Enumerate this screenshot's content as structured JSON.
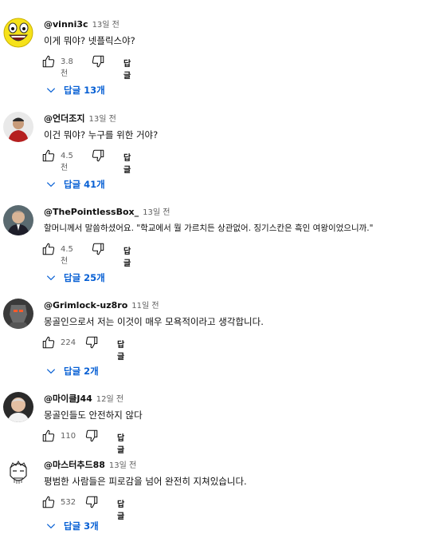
{
  "labels": {
    "reply": "답글"
  },
  "comments": [
    {
      "author": "@vinni3c",
      "time": "13일 전",
      "text": "이게 뭐야? 넷플릭스야?",
      "likes": "3.8천",
      "replies": "답글 13개"
    },
    {
      "author": "@언더조지",
      "time": "13일 전",
      "text": "이건 뭐야? 누구를 위한 거야?",
      "likes": "4.5천",
      "replies": "답글 41개"
    },
    {
      "author": "@ThePointlessBox_",
      "time": "13일 전",
      "text": "할머니께서 말씀하셨어요. \"학교에서 뭘 가르치든 상관없어. 징기스칸은 흑인 여왕이었으니까.\"",
      "likes": "4.5천",
      "replies": "답글 25개"
    },
    {
      "author": "@Grimlock-uz8ro",
      "time": "11일 전",
      "text": "몽골인으로서 저는 이것이 매우 모욕적이라고 생각합니다.",
      "likes": "224",
      "replies": "답글 2개"
    },
    {
      "author": "@마이클J44",
      "time": "12일 전",
      "text": "몽골인들도 안전하지 않다",
      "likes": "110",
      "replies": ""
    },
    {
      "author": "@마스터추드88",
      "time": "13일 전",
      "text": "평범한 사람들은 피로감을 넘어 완전히 지쳐있습니다.",
      "likes": "532",
      "replies": "답글 3개"
    }
  ]
}
